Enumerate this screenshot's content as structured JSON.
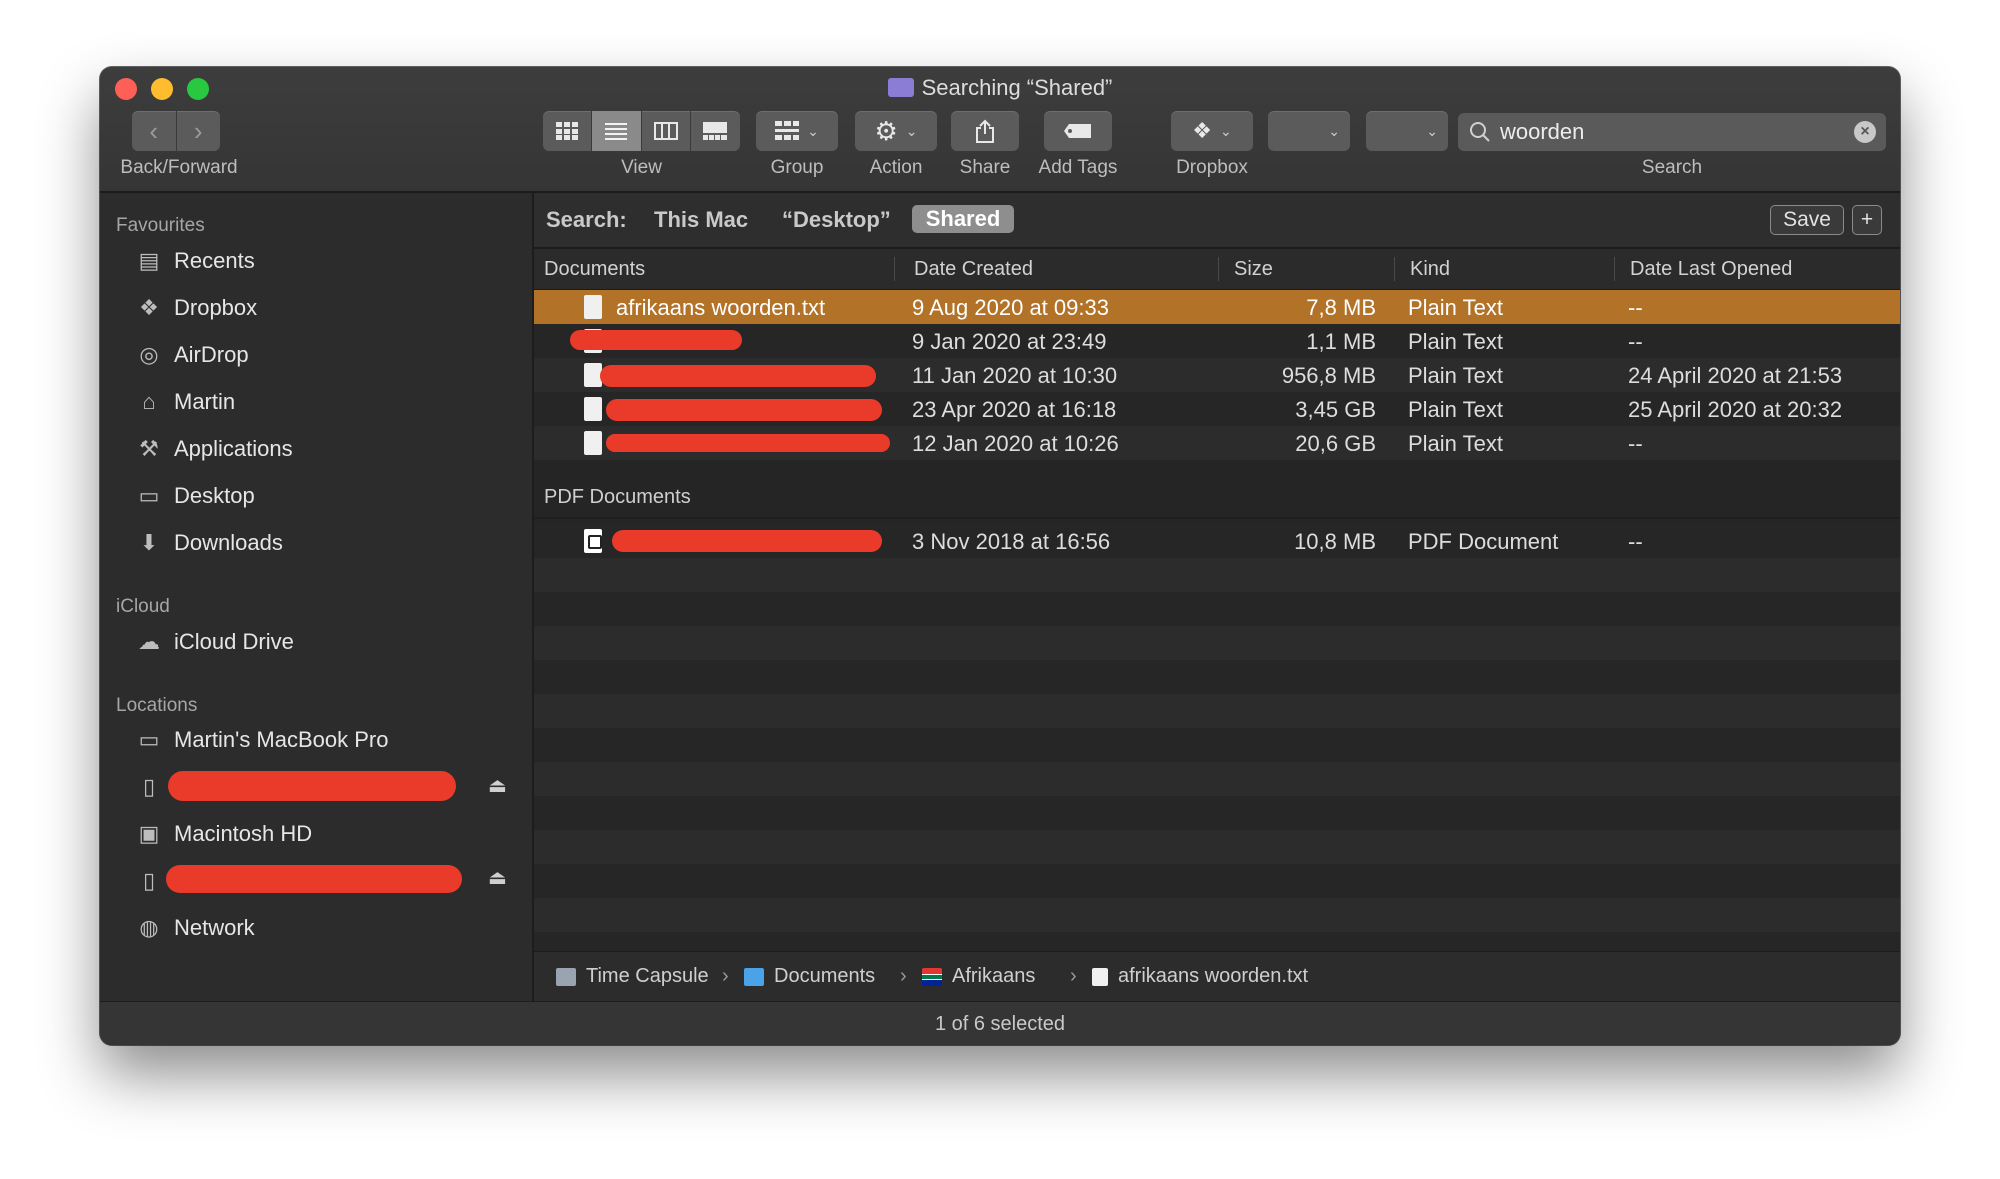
{
  "window": {
    "title": "Searching “Shared”",
    "status": "1 of 6 selected"
  },
  "toolbar": {
    "back_forward_label": "Back/Forward",
    "view_label": "View",
    "group_label": "Group",
    "action_label": "Action",
    "share_label": "Share",
    "add_tags_label": "Add Tags",
    "dropbox_label": "Dropbox",
    "search_label": "Search",
    "search_value": "woorden"
  },
  "sidebar": {
    "favourites_header": "Favourites",
    "favourites": [
      "Recents",
      "Dropbox",
      "AirDrop",
      "Martin",
      "Applications",
      "Desktop",
      "Downloads"
    ],
    "icloud_header": "iCloud",
    "icloud": [
      "iCloud Drive"
    ],
    "locations_header": "Locations",
    "locations": [
      "Martin's MacBook Pro",
      "Macintosh HD",
      "Network"
    ]
  },
  "scope": {
    "label": "Search:",
    "options": [
      "This Mac",
      "“Desktop”",
      "Shared"
    ],
    "save_label": "Save",
    "add_label": "+"
  },
  "columns": [
    "Documents",
    "Date Created",
    "Size",
    "Kind",
    "Date Last Opened"
  ],
  "groups": {
    "documents": "Documents",
    "pdf": "PDF Documents"
  },
  "rows": [
    {
      "name": "afrikaans woorden.txt",
      "created": "9 Aug 2020 at 09:33",
      "size": "7,8 MB",
      "kind": "Plain Text",
      "opened": "--"
    },
    {
      "name": "",
      "created": "9 Jan 2020 at 23:49",
      "size": "1,1 MB",
      "kind": "Plain Text",
      "opened": "--"
    },
    {
      "name": "",
      "created": "11 Jan 2020 at 10:30",
      "size": "956,8 MB",
      "kind": "Plain Text",
      "opened": "24 April 2020 at 21:53"
    },
    {
      "name": "",
      "created": "23 Apr 2020 at 16:18",
      "size": "3,45 GB",
      "kind": "Plain Text",
      "opened": "25 April 2020 at 20:32"
    },
    {
      "name": "",
      "created": "12 Jan 2020 at 10:26",
      "size": "20,6 GB",
      "kind": "Plain Text",
      "opened": "--"
    }
  ],
  "pdf_rows": [
    {
      "name": "",
      "created": "3 Nov 2018 at 16:56",
      "size": "10,8 MB",
      "kind": "PDF Document",
      "opened": "--"
    }
  ],
  "pathbar": [
    "Time Capsule",
    "Documents",
    "Afrikaans",
    "afrikaans woorden.txt"
  ],
  "colors": {
    "selection": "#b27227",
    "redaction": "#ea3b2a"
  }
}
